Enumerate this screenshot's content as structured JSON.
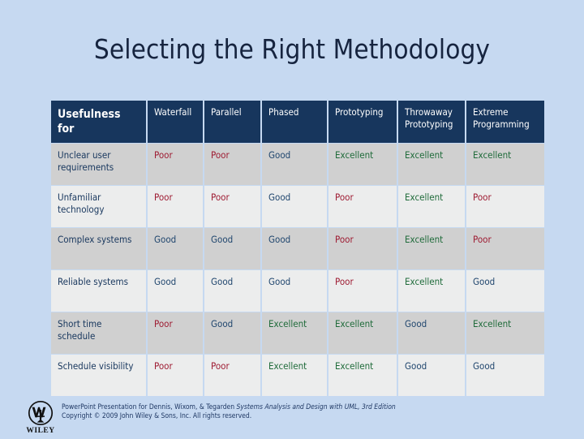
{
  "slide": {
    "title": "Selecting the Right Methodology",
    "background_color": "#c6d9f1",
    "title_color": "#16243f"
  },
  "table": {
    "header_bg": "#17365d",
    "header_text_color": "#ffffff",
    "shade_row_bg": "#d0d0d0",
    "plain_row_bg": "#eceded",
    "columns": [
      "Usefulness for",
      "Waterfall",
      "Parallel",
      "Phased",
      "Prototyping",
      "Throwaway Prototyping",
      "Extreme Programming"
    ],
    "rows": [
      {
        "label": "Unclear user requirements",
        "values": [
          "Poor",
          "Poor",
          "Good",
          "Excellent",
          "Excellent",
          "Excellent"
        ]
      },
      {
        "label": "Unfamiliar technology",
        "values": [
          "Poor",
          "Poor",
          "Good",
          "Poor",
          "Excellent",
          "Poor"
        ]
      },
      {
        "label": "Complex systems",
        "values": [
          "Good",
          "Good",
          "Good",
          "Poor",
          "Excellent",
          "Poor"
        ]
      },
      {
        "label": "Reliable systems",
        "values": [
          "Good",
          "Good",
          "Good",
          "Poor",
          "Excellent",
          "Good"
        ]
      },
      {
        "label": "Short time schedule",
        "values": [
          "Poor",
          "Good",
          "Excellent",
          "Excellent",
          "Good",
          "Excellent"
        ]
      },
      {
        "label": "Schedule visibility",
        "values": [
          "Poor",
          "Poor",
          "Excellent",
          "Excellent",
          "Good",
          "Good"
        ]
      }
    ],
    "value_colors": {
      "Poor": "#9e1b32",
      "Good": "#20466e",
      "Excellent": "#1f6b3a"
    }
  },
  "footer": {
    "logo_name": "wiley-logo",
    "logo_wordmark": "WILEY",
    "line1_prefix": "PowerPoint Presentation for Dennis, Wixom, & Tegarden ",
    "line1_italic": "Systems Analysis and Design with UML, 3rd Edition",
    "line2": "Copyright © 2009 John Wiley & Sons, Inc.  All rights reserved."
  }
}
